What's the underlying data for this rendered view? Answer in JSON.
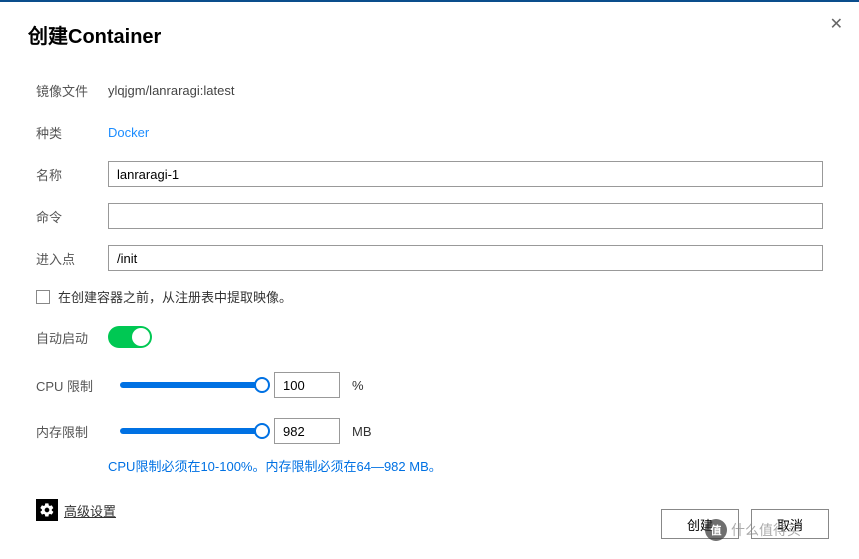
{
  "dialog": {
    "title": "创建Container"
  },
  "fields": {
    "image_label": "镜像文件",
    "image_value": "ylqjgm/lanraragi:latest",
    "type_label": "种类",
    "type_value": "Docker",
    "name_label": "名称",
    "name_value": "lanraragi-1",
    "command_label": "命令",
    "command_value": "",
    "entrypoint_label": "进入点",
    "entrypoint_value": "/init"
  },
  "options": {
    "pull_checkbox_label": "在创建容器之前，从注册表中提取映像。",
    "autostart_label": "自动启动",
    "autostart_on": true
  },
  "limits": {
    "cpu_label": "CPU 限制",
    "cpu_value": "100",
    "cpu_unit": "%",
    "mem_label": "内存限制",
    "mem_value": "982",
    "mem_unit": "MB",
    "hint": "CPU限制必须在10-100%。内存限制必须在64—982 MB。"
  },
  "advanced": {
    "label": "高级设置"
  },
  "buttons": {
    "create": "创建",
    "cancel": "取消"
  },
  "watermark": {
    "text": "什么值得买"
  }
}
